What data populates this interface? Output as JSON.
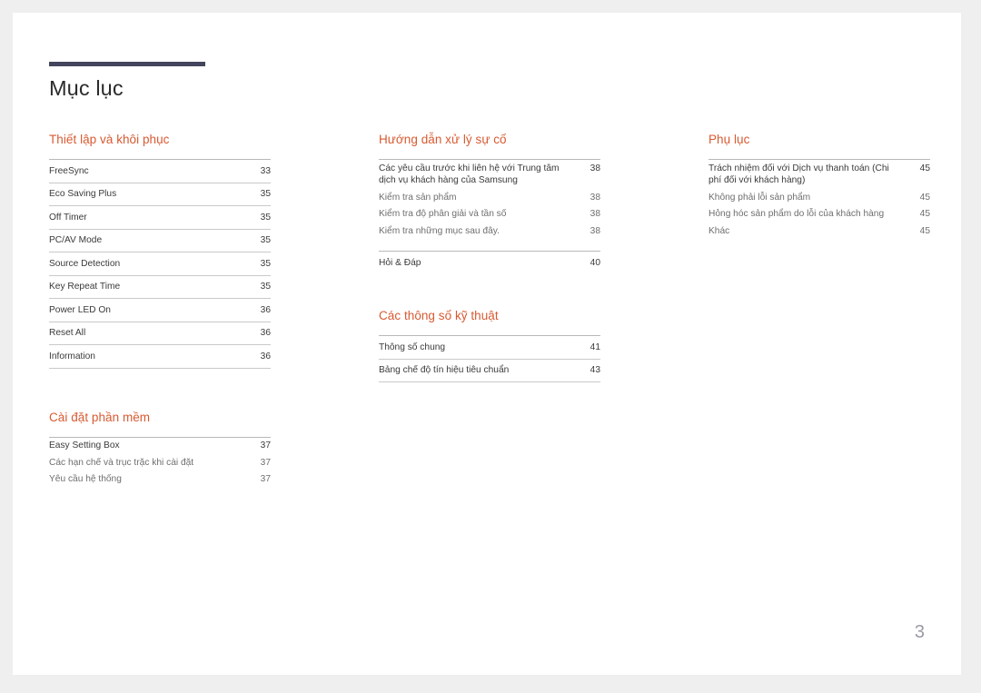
{
  "document": {
    "title": "Mục lục",
    "page_number": "3",
    "accent_color": "#d85a32",
    "bar_color": "#43455c"
  },
  "columns": [
    {
      "name": "column-left",
      "sections": [
        {
          "title": "Thiết lập và khôi phục",
          "style": "ruled",
          "entries": [
            {
              "label": "FreeSync",
              "page": "33",
              "level": "main"
            },
            {
              "label": "Eco Saving Plus",
              "page": "35",
              "level": "main"
            },
            {
              "label": "Off Timer",
              "page": "35",
              "level": "main"
            },
            {
              "label": "PC/AV Mode",
              "page": "35",
              "level": "main"
            },
            {
              "label": "Source Detection",
              "page": "35",
              "level": "main"
            },
            {
              "label": "Key Repeat Time",
              "page": "35",
              "level": "main"
            },
            {
              "label": "Power LED On",
              "page": "36",
              "level": "main"
            },
            {
              "label": "Reset All",
              "page": "36",
              "level": "main"
            },
            {
              "label": "Information",
              "page": "36",
              "level": "main"
            }
          ]
        },
        {
          "title": "Cài đặt phần mềm",
          "style": "plain",
          "entries": [
            {
              "label": "Easy Setting Box",
              "page": "37",
              "level": "main"
            },
            {
              "label": "Các hạn chế và trục trặc khi cài đặt",
              "page": "37",
              "level": "sub"
            },
            {
              "label": "Yêu cầu hệ thống",
              "page": "37",
              "level": "sub"
            }
          ]
        }
      ]
    },
    {
      "name": "column-middle",
      "sections": [
        {
          "title": "Hướng dẫn xử lý sự cố",
          "style": "plain",
          "entries": [
            {
              "label": "Các yêu cầu trước khi liên hệ với Trung tâm dịch vụ khách hàng của Samsung",
              "page": "38",
              "level": "main"
            },
            {
              "label": "Kiểm tra sản phẩm",
              "page": "38",
              "level": "sub"
            },
            {
              "label": "Kiểm tra độ phân giải và tần số",
              "page": "38",
              "level": "sub"
            },
            {
              "label": "Kiểm tra những mục sau đây.",
              "page": "38",
              "level": "sub"
            },
            {
              "label": "Hỏi & Đáp",
              "page": "40",
              "level": "main-divided"
            }
          ]
        },
        {
          "title": "Các thông số kỹ thuật",
          "style": "ruled",
          "entries": [
            {
              "label": "Thông số chung",
              "page": "41",
              "level": "main"
            },
            {
              "label": "Bảng chế độ tín hiệu tiêu chuẩn",
              "page": "43",
              "level": "main"
            }
          ]
        }
      ]
    },
    {
      "name": "column-right",
      "sections": [
        {
          "title": "Phụ lục",
          "style": "plain",
          "entries": [
            {
              "label": "Trách nhiệm đối với Dịch vụ thanh toán (Chi phí đối với khách hàng)",
              "page": "45",
              "level": "main"
            },
            {
              "label": "Không phải lỗi sản phẩm",
              "page": "45",
              "level": "sub"
            },
            {
              "label": "Hỏng hóc sản phẩm do lỗi của khách hàng",
              "page": "45",
              "level": "sub"
            },
            {
              "label": "Khác",
              "page": "45",
              "level": "sub"
            }
          ]
        }
      ]
    }
  ]
}
